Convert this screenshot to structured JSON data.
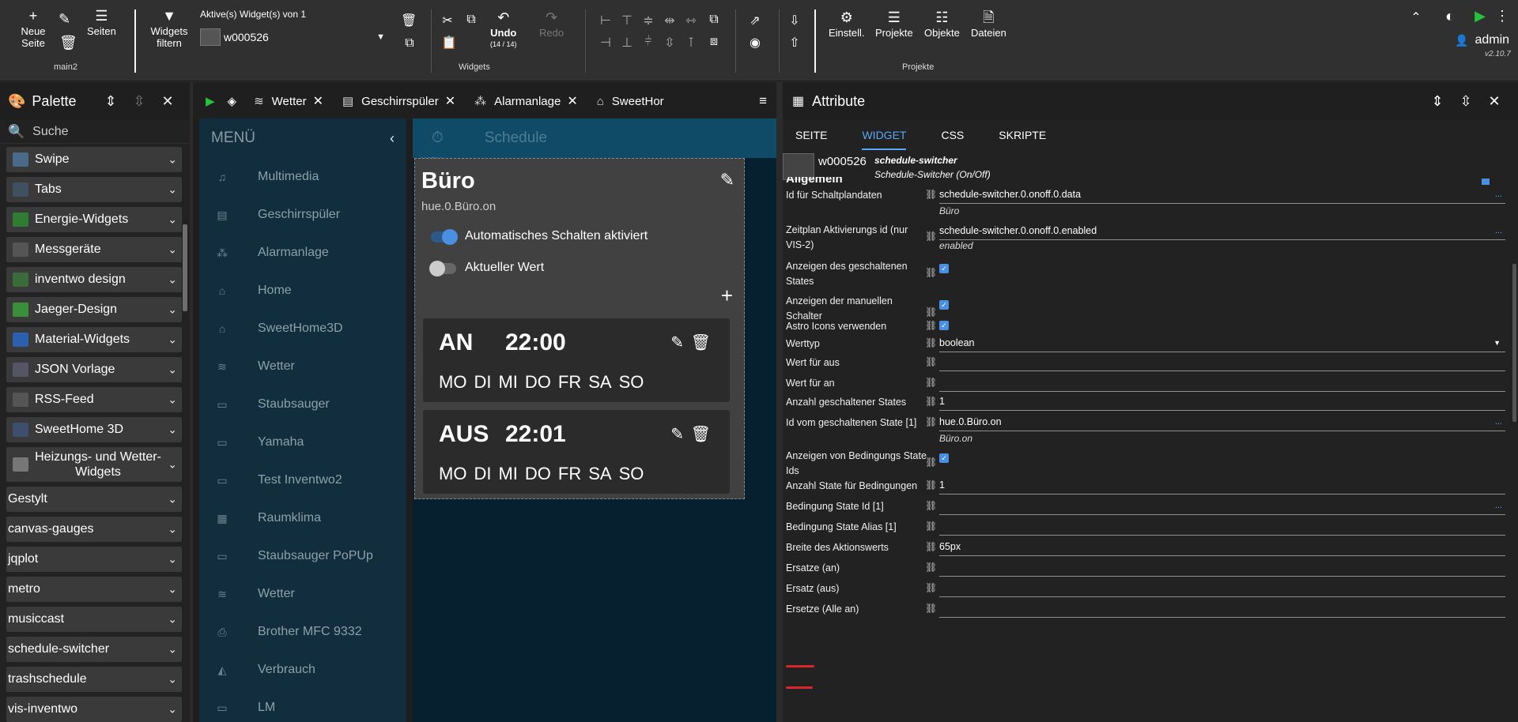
{
  "toolbar": {
    "new_page": "Neue Seite",
    "pages": "Seiten",
    "view_name": "main2",
    "filter_widgets": "Widgets filtern",
    "active_widgets": "Aktive(s) Widget(s) von 1",
    "selected_widget": "w000526",
    "undo": "Undo",
    "undo_count": "(14 / 14)",
    "redo": "Redo",
    "group_widgets": "Widgets",
    "settings": "Einstell.",
    "projects": "Projekte",
    "objects": "Objekte",
    "files": "Dateien",
    "group_projects": "Projekte",
    "user": "admin",
    "version": "v2.10.7"
  },
  "palette": {
    "title": "Palette",
    "search_placeholder": "Suche",
    "items": [
      {
        "label": "Swipe",
        "icon": "swipe-icon"
      },
      {
        "label": "Tabs",
        "icon": "tabs-icon"
      },
      {
        "label": "Energie-Widgets",
        "icon": "energy-icon"
      },
      {
        "label": "Messgeräte",
        "icon": "gauge-icon"
      },
      {
        "label": "inventwo design",
        "icon": "inventwo-icon"
      },
      {
        "label": "Jaeger-Design",
        "icon": "jaeger-icon"
      },
      {
        "label": "Material-Widgets",
        "icon": "material-icon"
      },
      {
        "label": "JSON Vorlage",
        "icon": "json-icon"
      },
      {
        "label": "RSS-Feed",
        "icon": "rss-icon"
      },
      {
        "label": "SweetHome 3D",
        "icon": "sweethome-icon"
      },
      {
        "label": "Heizungs- und Wetter-Widgets",
        "icon": "heating-icon"
      },
      {
        "label": "Gestylt"
      },
      {
        "label": "canvas-gauges"
      },
      {
        "label": "jqplot"
      },
      {
        "label": "metro"
      },
      {
        "label": "musiccast"
      },
      {
        "label": "schedule-switcher"
      },
      {
        "label": "trashschedule"
      },
      {
        "label": "vis-inventwo"
      }
    ]
  },
  "view_tabs": [
    "Wetter",
    "Geschirrspüler",
    "Alarmanlage",
    "SweetHor"
  ],
  "menu": {
    "title": "MENÜ",
    "items": [
      "Multimedia",
      "Geschirrspüler",
      "Alarmanlage",
      "Home",
      "SweetHome3D",
      "Wetter",
      "Staubsauger",
      "Yamaha",
      "Test Inventwo2",
      "Raumklima",
      "Staubsauger PoPUp",
      "Wetter",
      "Brother MFC 9332",
      "Verbrauch",
      "LM"
    ]
  },
  "schedule_bar": "Schedule",
  "widget": {
    "label": "w000526",
    "title": "Büro",
    "state_id": "hue.0.Büro.on",
    "auto_switch": "Automatisches Schalten aktiviert",
    "current_value": "Aktueller Wert",
    "cards": [
      {
        "state": "AN",
        "time": "22:00",
        "days": [
          "MO",
          "DI",
          "MI",
          "DO",
          "FR",
          "SA",
          "SO"
        ]
      },
      {
        "state": "AUS",
        "time": "22:01",
        "days": [
          "MO",
          "DI",
          "MI",
          "DO",
          "FR",
          "SA",
          "SO"
        ]
      }
    ]
  },
  "attributes": {
    "title": "Attribute",
    "tabs": [
      "SEITE",
      "WIDGET",
      "CSS",
      "SKRIPTE"
    ],
    "widget_id": "w000526",
    "widget_set": "schedule-switcher",
    "widget_type": "Schedule-Switcher (On/Off)",
    "section": "Allgemein",
    "rows": [
      {
        "label": "Id für Schaltplandaten",
        "value": "schedule-switcher.0.onoff.0.data",
        "sub": "Büro"
      },
      {
        "label": "Zeitplan Aktivierungs id (nur VIS-2)",
        "value": "schedule-switcher.0.onoff.0.enabled",
        "sub": "enabled"
      },
      {
        "label": "Anzeigen des geschaltenen States"
      },
      {
        "label": "Anzeigen der manuellen Schalter"
      },
      {
        "label": "Astro Icons verwenden"
      },
      {
        "label": "Werttyp",
        "value": "boolean"
      },
      {
        "label": "Wert für aus",
        "value": ""
      },
      {
        "label": "Wert für an",
        "value": ""
      },
      {
        "label": "Anzahl geschaltener States",
        "value": "1"
      },
      {
        "label": "Id vom geschaltenen State [1]",
        "value": "hue.0.Büro.on",
        "sub": "Büro.on"
      },
      {
        "label": "Anzeigen von Bedingungs State Ids"
      },
      {
        "label": "Anzahl State für Bedingungen",
        "value": "1"
      },
      {
        "label": "Bedingung State Id [1]",
        "value": ""
      },
      {
        "label": "Bedingung State Alias [1]",
        "value": ""
      },
      {
        "label": "Breite des Aktionswerts",
        "value": "65px"
      },
      {
        "label": "Ersatze (an)",
        "value": ""
      },
      {
        "label": "Ersatz (aus)",
        "value": ""
      },
      {
        "label": "Ersetze (Alle an)",
        "value": ""
      }
    ],
    "dots": "..."
  }
}
